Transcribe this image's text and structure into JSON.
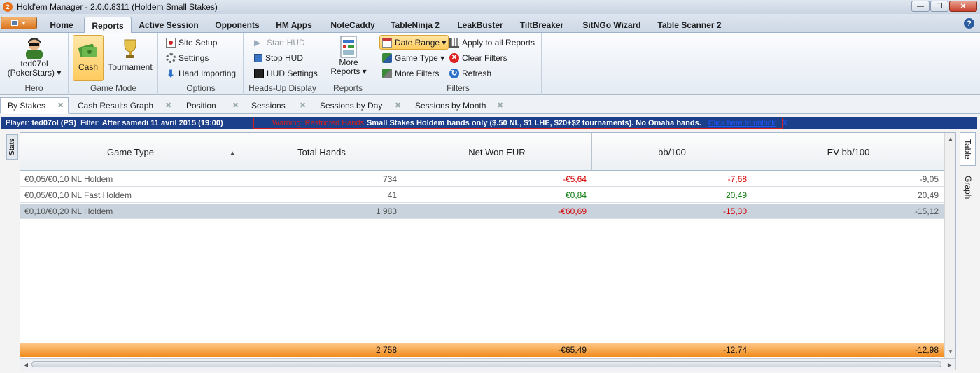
{
  "window": {
    "title": "Hold'em Manager - 2.0.0.8311 (Holdem Small Stakes)"
  },
  "menu_tabs": [
    "Home",
    "Reports",
    "Active Session",
    "Opponents",
    "HM Apps",
    "NoteCaddy",
    "TableNinja 2",
    "LeakBuster",
    "TiltBreaker",
    "SitNGo Wizard",
    "Table Scanner 2"
  ],
  "active_menu_tab": "Reports",
  "ribbon": {
    "hero": {
      "name": "ted07ol\n(PokerStars)",
      "name_line1": "ted07ol",
      "name_line2": "(PokerStars) ▾",
      "group_label": "Hero"
    },
    "game_mode": {
      "cash": "Cash",
      "tournament": "Tournament",
      "group_label": "Game Mode"
    },
    "options": {
      "site_setup": "Site Setup",
      "settings": "Settings",
      "hand_importing": "Hand Importing",
      "group_label": "Options"
    },
    "hud": {
      "start": "Start HUD",
      "stop": "Stop HUD",
      "settings": "HUD Settings",
      "group_label": "Heads-Up Display"
    },
    "reports": {
      "more_line1": "More",
      "more_line2": "Reports ▾",
      "group_label": "Reports"
    },
    "filters": {
      "date_range": "Date Range ▾",
      "game_type": "Game Type ▾",
      "more_filters": "More Filters",
      "apply_all": "Apply to all Reports",
      "clear": "Clear Filters",
      "refresh": "Refresh",
      "group_label": "Filters"
    }
  },
  "report_tabs": [
    "By Stakes",
    "Cash Results Graph",
    "Position",
    "Sessions",
    "Sessions by Day",
    "Sessions by Month"
  ],
  "filter_bar": {
    "player_label": "Player:",
    "player": "ted07ol (PS)",
    "filter_label": "Filter:",
    "filter": "After samedi 11 avril 2015 (19:00)",
    "warning": "Warning: Restricted Hands",
    "message": "Small Stakes Holdem hands only ($.50 NL, $1 LHE, $20+$2 tournaments).  No Omaha hands.",
    "unlock": "Click here to unlock",
    "close": "X"
  },
  "side_tabs": {
    "stats": "Stats",
    "table": "Table",
    "graph": "Graph"
  },
  "table": {
    "columns": [
      "Game Type",
      "Total Hands",
      "Net Won EUR",
      "bb/100",
      "EV bb/100"
    ],
    "rows": [
      {
        "game": "€0,05/€0,10 NL Holdem",
        "hands": "734",
        "net": "-€5,64",
        "bb": "-7,68",
        "ev": "-9,05"
      },
      {
        "game": "€0,05/€0,10 NL Fast Holdem",
        "hands": "41",
        "net": "€0,84",
        "bb": "20,49",
        "ev": "20,49"
      },
      {
        "game": "€0,10/€0,20 NL Holdem",
        "hands": "1 983",
        "net": "-€60,69",
        "bb": "-15,30",
        "ev": "-15,12"
      }
    ],
    "totals": {
      "hands": "2 758",
      "net": "-€65,49",
      "bb": "-12,74",
      "ev": "-12,98"
    }
  },
  "colors": {
    "accent": "#f08a1a",
    "negative": "#d40000",
    "positive": "#0b7a0b",
    "filter_bar": "#1b3f8a"
  }
}
